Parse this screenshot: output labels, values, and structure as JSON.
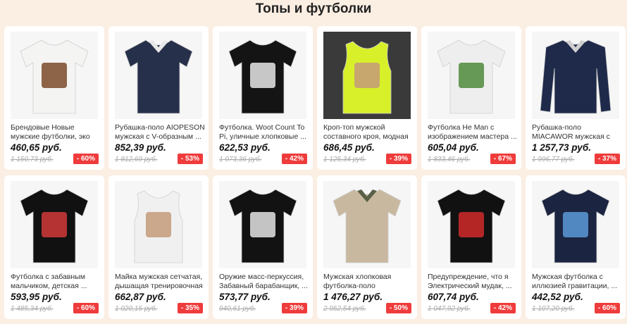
{
  "section": {
    "title": "Топы и футболки"
  },
  "products": [
    {
      "name": "Брендовые Новые мужские футболки, эко воины Ewo...",
      "price": "460,65 руб.",
      "old_price": "1 150,73 руб.",
      "discount": "- 60%",
      "icon": "tshirt-white-ewok-icon",
      "shirt_color": "#f4f4f2",
      "print_color": "#7a4a2a"
    },
    {
      "name": "Рубашка-поло AIOPESON мужская с V-образным ...",
      "price": "852,39 руб.",
      "old_price": "1 812,69 руб.",
      "discount": "- 53%",
      "icon": "polo-navy-icon",
      "shirt_color": "#27304a",
      "print_color": "#e8e8e8"
    },
    {
      "name": "Футболка. Woot Count To Pi, уличные хлопковые ...",
      "price": "622,53 руб.",
      "old_price": "1 073,36 руб.",
      "discount": "- 42%",
      "icon": "tshirt-black-pi-icon",
      "shirt_color": "#141414",
      "print_color": "#e6e6e6"
    },
    {
      "name": "Кроп-топ мужской составного кроя, модная ...",
      "price": "686,45 руб.",
      "old_price": "1 125,34 руб.",
      "discount": "- 39%",
      "icon": "crop-top-neon-icon",
      "shirt_color": "#d7f02a",
      "print_color": "#c49a7a"
    },
    {
      "name": "Футболка He Man с изображением мастера ...",
      "price": "605,04 руб.",
      "old_price": "1 833,46 руб.",
      "discount": "- 67%",
      "icon": "tshirt-white-heman-icon",
      "shirt_color": "#eeeeee",
      "print_color": "#4d8a3a"
    },
    {
      "name": "Рубашка-поло MIACAWOR мужская с воротником-...",
      "price": "1 257,73 руб.",
      "old_price": "1 996,77 руб.",
      "discount": "- 37%",
      "icon": "longsleeve-navy-icon",
      "shirt_color": "#1f2a4a",
      "print_color": "#d0d0d0"
    },
    {
      "name": "Футболка с забавным мальчиком, детская ...",
      "price": "593,95 руб.",
      "old_price": "1 485,34 руб.",
      "discount": "- 60%",
      "icon": "tshirt-black-hockey-icon",
      "shirt_color": "#111111",
      "print_color": "#d23a3a"
    },
    {
      "name": "Майка мужская сетчатая, дышащая тренировочная ...",
      "price": "662,87 руб.",
      "old_price": "1 020,15 руб.",
      "discount": "- 35%",
      "icon": "tank-top-white-icon",
      "shirt_color": "#f0f0f0",
      "print_color": "#c49a7a"
    },
    {
      "name": "Оружие масс-перкуссия, Забавный барабанщик, ...",
      "price": "573,77 руб.",
      "old_price": "940,61 руб.",
      "discount": "- 39%",
      "icon": "tshirt-black-drums-icon",
      "shirt_color": "#121212",
      "print_color": "#e4e4e4"
    },
    {
      "name": "Мужская хлопковая футболка-поло AIOPESON,...",
      "price": "1 476,27 руб.",
      "old_price": "2 952,54 руб.",
      "discount": "- 50%",
      "icon": "polo-olive-icon",
      "shirt_color": "#c9b8a0",
      "print_color": "#5a6048"
    },
    {
      "name": "Предупреждение, что я Электрический мудак, ...",
      "price": "607,74 руб.",
      "old_price": "1 047,92 руб.",
      "discount": "- 42%",
      "icon": "tshirt-black-warning-icon",
      "shirt_color": "#111111",
      "print_color": "#d12a2a"
    },
    {
      "name": "Мужская футболка с иллюзией гравитации, ...",
      "price": "442,52 руб.",
      "old_price": "1 107,20 руб.",
      "discount": "- 60%",
      "icon": "tshirt-navy-triangle-icon",
      "shirt_color": "#1b2440",
      "print_color": "#5a9ad8"
    }
  ]
}
